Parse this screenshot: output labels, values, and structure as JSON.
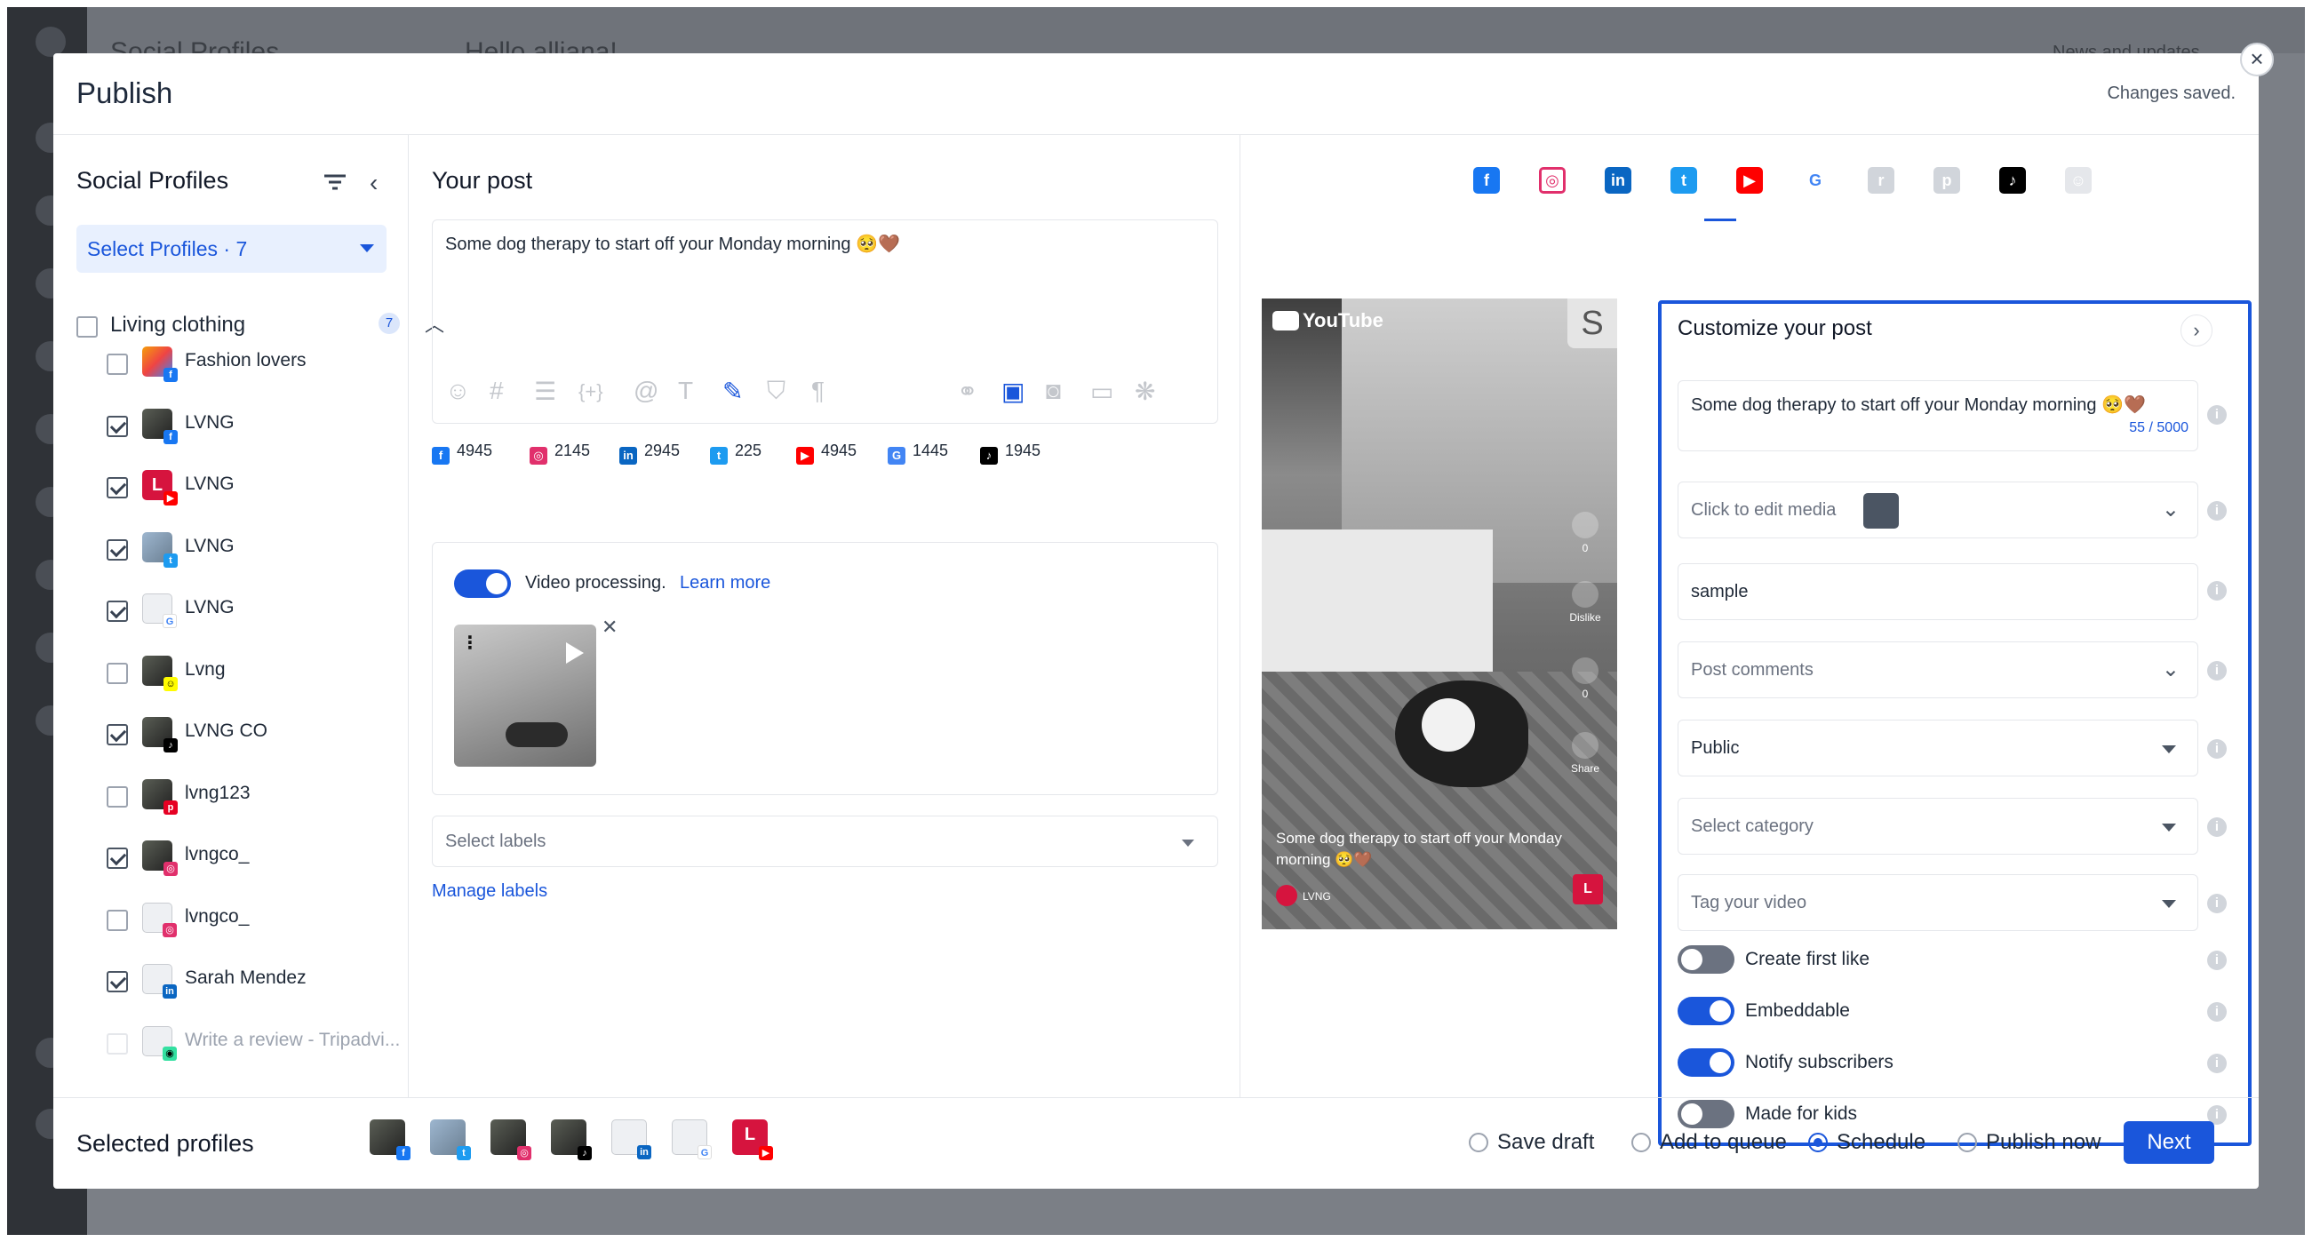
{
  "backdrop": {
    "title_left": "Social Profiles",
    "title_center": "Hello alliana!",
    "title_right": "News and updates"
  },
  "modal": {
    "title": "Publish",
    "status": "Changes saved.",
    "close_glyph": "×"
  },
  "profiles_panel": {
    "title": "Social Profiles",
    "select_label": "Select Profiles · 7",
    "group": {
      "name": "Living clothing",
      "count": "7"
    },
    "items": [
      {
        "name": "Fashion lovers",
        "checked": false,
        "avatar": "collage",
        "network": "facebook"
      },
      {
        "name": "LVNG",
        "checked": true,
        "avatar": "photo",
        "network": "facebook"
      },
      {
        "name": "LVNG",
        "checked": true,
        "avatar": "red-L",
        "network": "youtube"
      },
      {
        "name": "LVNG",
        "checked": true,
        "avatar": "blue-photo",
        "network": "twitter"
      },
      {
        "name": "LVNG",
        "checked": true,
        "avatar": "building",
        "network": "google"
      },
      {
        "name": "Lvng",
        "checked": false,
        "avatar": "photo",
        "network": "snapchat"
      },
      {
        "name": "LVNG CO",
        "checked": true,
        "avatar": "photo",
        "network": "tiktok"
      },
      {
        "name": "lvng123",
        "checked": false,
        "avatar": "photo",
        "network": "pinterest"
      },
      {
        "name": "lvngco_",
        "checked": true,
        "avatar": "photo",
        "network": "instagram"
      },
      {
        "name": "lvngco_",
        "checked": false,
        "avatar": "building",
        "network": "instagram"
      },
      {
        "name": "Sarah Mendez",
        "checked": true,
        "avatar": "building",
        "network": "linkedin"
      },
      {
        "name": "Write a review - Tripadvi...",
        "checked": false,
        "avatar": "building",
        "network": "tripadvisor",
        "disabled": true
      }
    ]
  },
  "post": {
    "title": "Your post",
    "text": "Some dog therapy to start off your Monday morning 🥺🤎",
    "counts": [
      {
        "network": "facebook",
        "value": "4945",
        "color": "#1877f2",
        "glyph": "f"
      },
      {
        "network": "instagram",
        "value": "2145",
        "color": "#e1306c",
        "glyph": "◎"
      },
      {
        "network": "linkedin",
        "value": "2945",
        "color": "#0a66c2",
        "glyph": "in"
      },
      {
        "network": "twitter",
        "value": "225",
        "color": "#1d9bf0",
        "glyph": "t"
      },
      {
        "network": "youtube",
        "value": "4945",
        "color": "#ff0000",
        "glyph": "▶"
      },
      {
        "network": "google",
        "value": "1445",
        "color": "#4285f4",
        "glyph": "G"
      },
      {
        "network": "tiktok",
        "value": "1945",
        "color": "#000000",
        "glyph": "♪"
      }
    ],
    "video_processing_label": "Video processing.",
    "learn_more": "Learn more",
    "labels_placeholder": "Select labels",
    "manage_labels": "Manage labels"
  },
  "network_tabs": [
    {
      "name": "facebook",
      "glyph": "f",
      "color": "#1877f2"
    },
    {
      "name": "instagram",
      "glyph": "◎",
      "color": "#e1306c"
    },
    {
      "name": "linkedin",
      "glyph": "in",
      "color": "#0a66c2"
    },
    {
      "name": "twitter",
      "glyph": "t",
      "color": "#1d9bf0"
    },
    {
      "name": "youtube",
      "glyph": "▶",
      "color": "#ff0000",
      "active": true
    },
    {
      "name": "google",
      "glyph": "G",
      "color": "#4285f4"
    },
    {
      "name": "reddit",
      "glyph": "r",
      "color": "#d1d5db"
    },
    {
      "name": "pinterest",
      "glyph": "p",
      "color": "#d1d5db"
    },
    {
      "name": "tiktok",
      "glyph": "♪",
      "color": "#000000"
    },
    {
      "name": "snapchat",
      "glyph": "☺",
      "color": "#e5e7eb"
    }
  ],
  "preview": {
    "brand": "YouTube",
    "caption": "Some dog therapy to start off your Monday morning 🥺🤎",
    "channel": "LVNG",
    "likes": "0",
    "dislike_label": "Dislike",
    "comments": "0",
    "share_label": "Share",
    "avatar_letter": "L"
  },
  "customize": {
    "title": "Customize your post",
    "text": "Some dog therapy to start off your Monday morning 🥺🤎",
    "char_count": "55 / 5000",
    "media_label": "Click to edit media",
    "title_value": "sample",
    "comments_placeholder": "Post comments",
    "privacy": "Public",
    "category_placeholder": "Select category",
    "tags_placeholder": "Tag your video",
    "toggles": [
      {
        "label": "Create first like",
        "on": false
      },
      {
        "label": "Embeddable",
        "on": true
      },
      {
        "label": "Notify subscribers",
        "on": true
      },
      {
        "label": "Made for kids",
        "on": false
      }
    ]
  },
  "footer": {
    "title": "Selected profiles",
    "options": [
      {
        "label": "Save draft",
        "selected": false
      },
      {
        "label": "Add to queue",
        "selected": false
      },
      {
        "label": "Schedule",
        "selected": true
      },
      {
        "label": "Publish now",
        "selected": false
      }
    ],
    "next": "Next"
  },
  "colors": {
    "accent": "#1a56db",
    "brand_red": "#d6143e"
  }
}
